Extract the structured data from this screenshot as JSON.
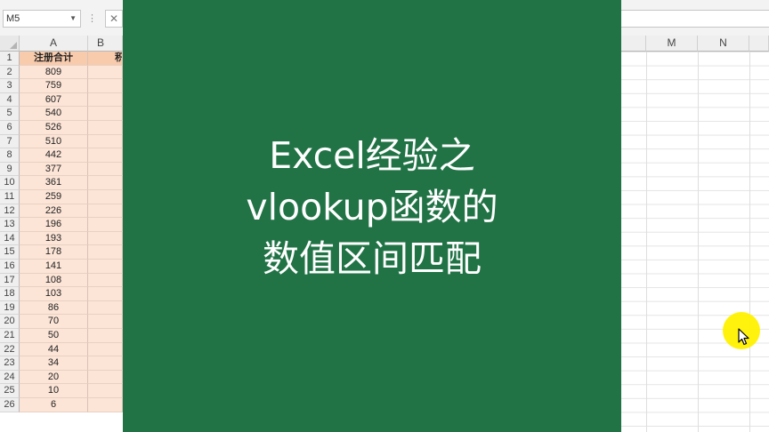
{
  "name_box": {
    "value": "M5"
  },
  "formula_bar": {
    "dots": "⋮",
    "cancel": "✕"
  },
  "columns": {
    "a": "A",
    "b": "B",
    "m": "M",
    "n": "N"
  },
  "rows": [
    {
      "n": "1",
      "a": "注册合计",
      "b": "积"
    },
    {
      "n": "2",
      "a": "809",
      "b": ""
    },
    {
      "n": "3",
      "a": "759",
      "b": ""
    },
    {
      "n": "4",
      "a": "607",
      "b": ""
    },
    {
      "n": "5",
      "a": "540",
      "b": ""
    },
    {
      "n": "6",
      "a": "526",
      "b": ""
    },
    {
      "n": "7",
      "a": "510",
      "b": ""
    },
    {
      "n": "8",
      "a": "442",
      "b": ""
    },
    {
      "n": "9",
      "a": "377",
      "b": ""
    },
    {
      "n": "10",
      "a": "361",
      "b": ""
    },
    {
      "n": "11",
      "a": "259",
      "b": ""
    },
    {
      "n": "12",
      "a": "226",
      "b": ""
    },
    {
      "n": "13",
      "a": "196",
      "b": ""
    },
    {
      "n": "14",
      "a": "193",
      "b": ""
    },
    {
      "n": "15",
      "a": "178",
      "b": ""
    },
    {
      "n": "16",
      "a": "141",
      "b": ""
    },
    {
      "n": "17",
      "a": "108",
      "b": ""
    },
    {
      "n": "18",
      "a": "103",
      "b": ""
    },
    {
      "n": "19",
      "a": "86",
      "b": ""
    },
    {
      "n": "20",
      "a": "70",
      "b": ""
    },
    {
      "n": "21",
      "a": "50",
      "b": ""
    },
    {
      "n": "22",
      "a": "44",
      "b": ""
    },
    {
      "n": "23",
      "a": "34",
      "b": ""
    },
    {
      "n": "24",
      "a": "20",
      "b": ""
    },
    {
      "n": "25",
      "a": "10",
      "b": ""
    },
    {
      "n": "26",
      "a": "6",
      "b": ""
    }
  ],
  "overlay": {
    "line1": "Excel经验之",
    "line2": "vlookup函数的",
    "line3": "数值区间匹配",
    "color": "#217346"
  },
  "cursor": {
    "highlight_color": "#fff200"
  }
}
